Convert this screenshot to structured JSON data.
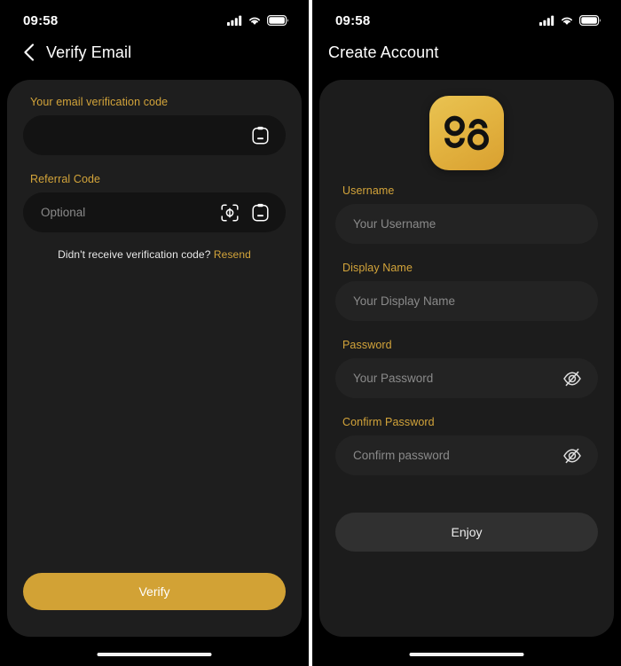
{
  "colors": {
    "accent_gold": "#d3a43a",
    "button_gold": "#d2a235",
    "screen_background": "#000000",
    "card_background": "#1e1e1e",
    "input_background": "#131313",
    "input_background_light": "#232323",
    "placeholder_text": "#8a8a8a",
    "secondary_button": "#303030"
  },
  "left_screen": {
    "status_bar": {
      "time": "09:58",
      "icons": [
        "cellular-signal-icon",
        "wifi-icon",
        "battery-icon"
      ]
    },
    "nav": {
      "back_icon": "back-chevron-icon",
      "title": "Verify Email"
    },
    "verification_field": {
      "label": "Your email verification code",
      "value": "",
      "placeholder": "",
      "trailing_icons": [
        "paste-clipboard-icon"
      ]
    },
    "referral_field": {
      "label": "Referral Code",
      "value": "",
      "placeholder": "Optional",
      "trailing_icons": [
        "scan-code-icon",
        "paste-clipboard-icon"
      ]
    },
    "resend": {
      "prompt": "Didn't receive verification code?",
      "link_label": "Resend"
    },
    "primary_button": {
      "label": "Verify"
    }
  },
  "right_screen": {
    "status_bar": {
      "time": "09:58",
      "icons": [
        "cellular-signal-icon",
        "wifi-icon",
        "battery-icon"
      ]
    },
    "nav": {
      "title": "Create Account"
    },
    "logo": {
      "name": "app-logo-icon",
      "alt": "98 / go mark"
    },
    "fields": [
      {
        "label": "Username",
        "placeholder": "Your Username",
        "value": "",
        "trailing_icon": null
      },
      {
        "label": "Display Name",
        "placeholder": "Your Display Name",
        "value": "",
        "trailing_icon": null
      },
      {
        "label": "Password",
        "placeholder": "Your Password",
        "value": "",
        "trailing_icon": "eye-off-icon"
      },
      {
        "label": "Confirm Password",
        "placeholder": "Confirm password",
        "value": "",
        "trailing_icon": "eye-off-icon"
      }
    ],
    "submit_button": {
      "label": "Enjoy"
    }
  }
}
